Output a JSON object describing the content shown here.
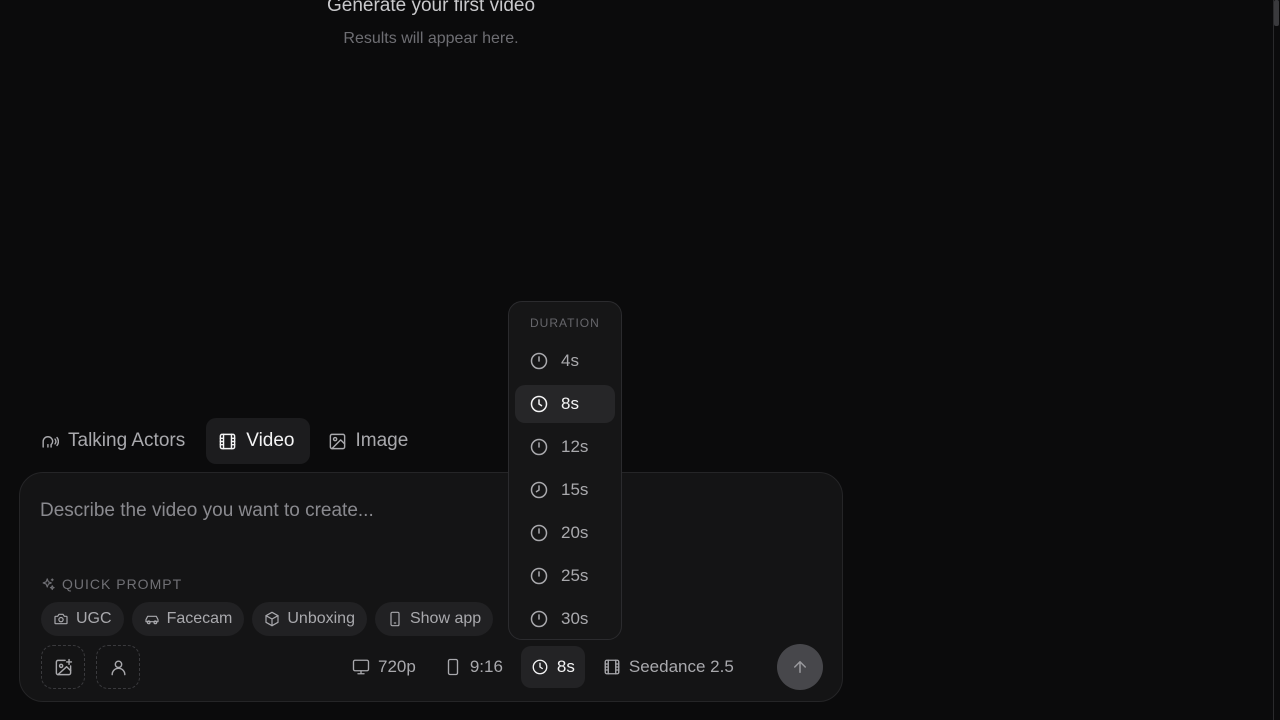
{
  "empty_state": {
    "title": "Generate your first video",
    "subtitle": "Results will appear here."
  },
  "mode_tabs": [
    {
      "label": "Talking Actors",
      "icon": "talking-head-icon",
      "active": false
    },
    {
      "label": "Video",
      "icon": "film-icon",
      "active": true
    },
    {
      "label": "Image",
      "icon": "image-icon",
      "active": false
    }
  ],
  "composer": {
    "placeholder": "Describe the video you want to create...",
    "quick_prompt_label": "QUICK PROMPT",
    "chips": [
      {
        "label": "UGC",
        "icon": "camera-icon"
      },
      {
        "label": "Facecam",
        "icon": "car-icon"
      },
      {
        "label": "Unboxing",
        "icon": "box-icon"
      },
      {
        "label": "Show app",
        "icon": "phone-icon"
      }
    ],
    "settings": {
      "resolution": "720p",
      "aspect_ratio": "9:16",
      "duration": "8s",
      "model": "Seedance 2.5"
    }
  },
  "duration_menu": {
    "header": "DURATION",
    "options": [
      "4s",
      "8s",
      "12s",
      "15s",
      "20s",
      "25s",
      "30s"
    ],
    "selected": "8s"
  },
  "colors": {
    "background": "#0b0b0c",
    "panel": "#141415",
    "active": "#262628",
    "send_button": "#47474b"
  }
}
